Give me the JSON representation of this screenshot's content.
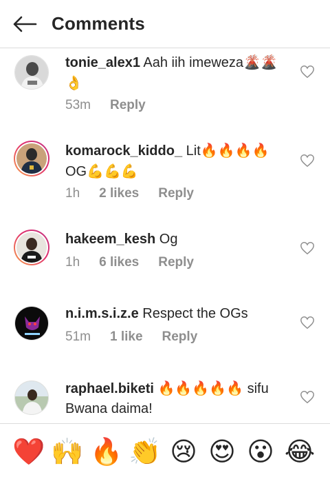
{
  "header": {
    "title": "Comments"
  },
  "comments": [
    {
      "username": "tonie_alex1",
      "text": "Aah iih imeweza",
      "emojis": "🌋🌋👌",
      "time": "53m",
      "likes": "",
      "reply": "Reply"
    },
    {
      "username": "komarock_kiddo_",
      "text": "Lit",
      "emojis": "🔥🔥🔥🔥",
      "text2": "OG",
      "emojis2": "💪💪💪",
      "time": "1h",
      "likes": "2 likes",
      "reply": "Reply"
    },
    {
      "username": "hakeem_kesh",
      "text": "Og",
      "time": "1h",
      "likes": "6 likes",
      "reply": "Reply"
    },
    {
      "username": "n.i.m.s.i.z.e",
      "text": "Respect the OGs",
      "time": "51m",
      "likes": "1 like",
      "reply": "Reply"
    },
    {
      "username": "raphael.biketi",
      "emojis": "🔥🔥🔥🔥🔥",
      "text": "sifu Bwana daima!"
    }
  ],
  "reactions": [
    "❤️",
    "🙌",
    "🔥",
    "👏",
    "😢",
    "😍",
    "😮",
    "😂"
  ]
}
